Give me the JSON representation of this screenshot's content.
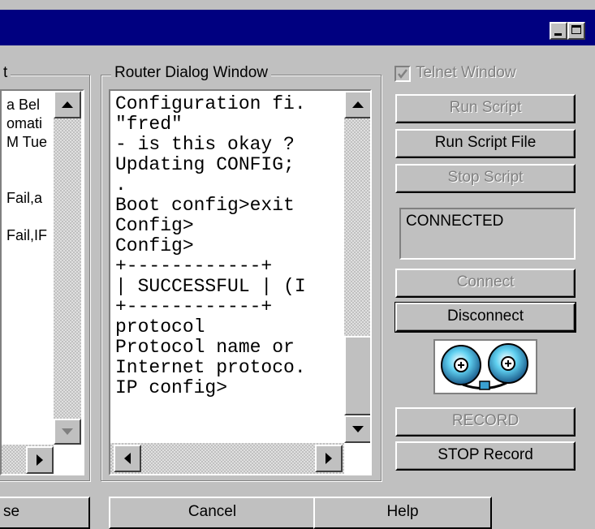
{
  "window": {
    "left_group_fragment": "t",
    "router_group_title": "Router Dialog Window"
  },
  "left_panel": {
    "lines": [
      "a Bel",
      "omati",
      "M Tue",
      "",
      "",
      "Fail,a",
      "",
      "Fail,IF"
    ]
  },
  "router_dialog": {
    "lines": [
      "Configuration fi.",
      "\"fred\"",
      "- is this okay ?",
      "Updating CONFIG;",
      ".",
      "Boot config>exit",
      "Config>",
      "Config>",
      "+------------+",
      "| SUCCESSFUL | (I",
      "+------------+",
      "protocol",
      "Protocol name or",
      "Internet protoco.",
      "IP config>"
    ]
  },
  "controls": {
    "telnet_window_label": "Telnet Window",
    "telnet_window_checked": true,
    "run_script": "Run Script",
    "run_script_file": "Run Script File",
    "stop_script": "Stop Script",
    "status_text": "CONNECTED",
    "connect": "Connect",
    "disconnect": "Disconnect",
    "record": "RECORD",
    "stop_record": "STOP Record"
  },
  "bottom_buttons": {
    "left_fragment": "se",
    "cancel": "Cancel",
    "help": "Help"
  },
  "icons": {
    "tape_icon": "cassette-tape-icon",
    "minimize": "minimize-icon",
    "maximize": "maximize-icon"
  }
}
